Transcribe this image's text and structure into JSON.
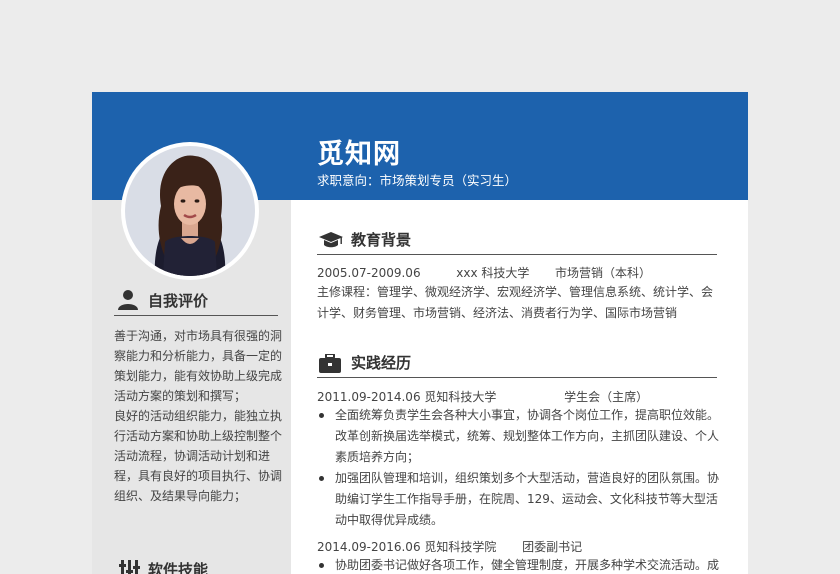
{
  "header": {
    "name": "觅知网",
    "intent": "求职意向：市场策划专员（实习生）"
  },
  "sidebar": {
    "self_eval": {
      "title": "自我评价",
      "icon": "person-icon",
      "paragraphs": [
        "善于沟通，对市场具有很强的洞察能力和分析能力，具备一定的策划能力，能有效协助上级完成活动方案的策划和撰写；",
        "良好的活动组织能力，能独立执行活动方案和协助上级控制整个活动流程，协调活动计划和进程，具有良好的项目执行、协调组织、及结果导向能力；"
      ]
    },
    "software": {
      "title": "软件技能",
      "icon": "tools-icon"
    }
  },
  "education": {
    "title": "教育背景",
    "icon": "graduation-cap-icon",
    "period": "2005.07-2009.06",
    "school": "xxx 科技大学",
    "major": "市场营销（本科）",
    "courses": "主修课程：管理学、微观经济学、宏观经济学、管理信息系统、统计学、会计学、财务管理、市场营销、经济法、消费者行为学、国际市场营销"
  },
  "practice": {
    "title": "实践经历",
    "icon": "briefcase-icon",
    "entries": [
      {
        "header": "2011.09-2014.06 觅知科技大学",
        "role": "学生会（主席）",
        "bullets": [
          "全面统筹负责学生会各种大小事宜，协调各个岗位工作，提高职位效能。改革创新换届选举模式，统筹、规划整体工作方向，主抓团队建设、个人素质培养方向；",
          "加强团队管理和培训，组织策划多个大型活动，营造良好的团队氛围。协助编订学生工作指导手册，在院周、129、运动会、文化科技节等大型活动中取得优异成绩。"
        ]
      },
      {
        "header": "2014.09-2016.06 觅知科技学院",
        "role": "团委副书记",
        "bullets": [
          "协助团委书记做好各项工作，健全管理制度，开展多种学术交流活动。成功"
        ]
      }
    ]
  }
}
